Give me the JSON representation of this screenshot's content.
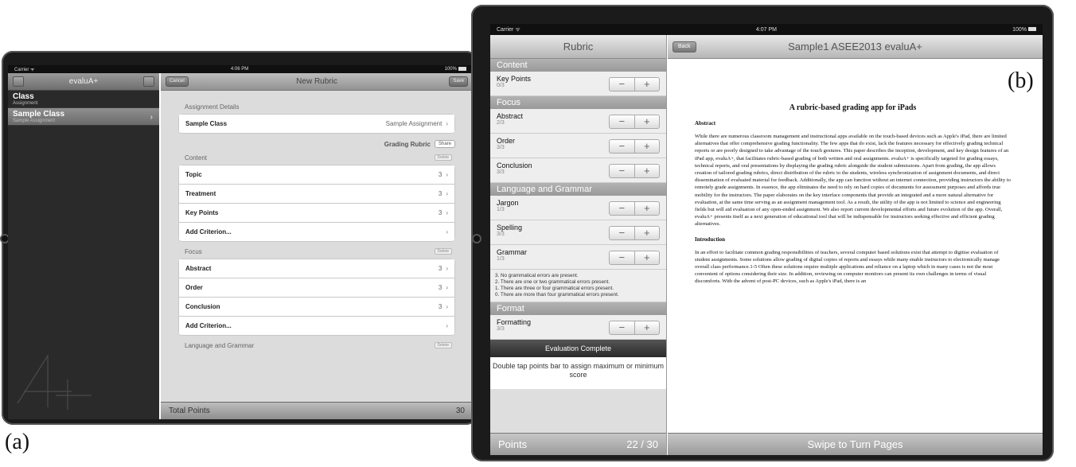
{
  "labels": {
    "a": "(a)",
    "b": "(b)"
  },
  "screen_a": {
    "status": {
      "carrier": "Carrier ᯤ",
      "time": "4:06 PM",
      "battery": "100%"
    },
    "sidebar": {
      "title": "evaluA+",
      "items": [
        {
          "title": "Class",
          "subtitle": "Assignment"
        },
        {
          "title": "Sample Class",
          "subtitle": "Sample Assignment",
          "chevron": "›"
        }
      ]
    },
    "nav": {
      "cancel": "Cancel",
      "title": "New Rubric",
      "save": "Save"
    },
    "assignment": {
      "header": "Assignment Details",
      "row": {
        "label": "Sample Class",
        "value": "Sample Assignment",
        "chevron": "›"
      }
    },
    "rubric": {
      "label": "Grading Rubric",
      "share": "Share"
    },
    "groups": [
      {
        "title": "Content",
        "delete": "Delete",
        "items": [
          {
            "label": "Topic",
            "value": "3",
            "chevron": "›"
          },
          {
            "label": "Treatment",
            "value": "3",
            "chevron": "›"
          },
          {
            "label": "Key Points",
            "value": "3",
            "chevron": "›"
          },
          {
            "label": "Add Criterion...",
            "value": "",
            "chevron": "›"
          }
        ]
      },
      {
        "title": "Focus",
        "delete": "Delete",
        "items": [
          {
            "label": "Abstract",
            "value": "3",
            "chevron": "›"
          },
          {
            "label": "Order",
            "value": "3",
            "chevron": "›"
          },
          {
            "label": "Conclusion",
            "value": "3",
            "chevron": "›"
          },
          {
            "label": "Add Criterion...",
            "value": "",
            "chevron": "›"
          }
        ]
      },
      {
        "title": "Language and Grammar",
        "delete": "Delete",
        "items": []
      }
    ],
    "total": {
      "label": "Total Points",
      "value": "30"
    }
  },
  "screen_b": {
    "status": {
      "carrier": "Carrier ᯤ",
      "time": "4:07 PM",
      "battery": "100%"
    },
    "sidebar": {
      "title": "Rubric",
      "sections": [
        {
          "name": "Content",
          "items": [
            {
              "name": "Key Points",
              "score": "0/3"
            }
          ]
        },
        {
          "name": "Focus",
          "items": [
            {
              "name": "Abstract",
              "score": "2/3"
            },
            {
              "name": "Order",
              "score": "3/3"
            },
            {
              "name": "Conclusion",
              "score": "3/3"
            }
          ]
        },
        {
          "name": "Language and Grammar",
          "items": [
            {
              "name": "Jargon",
              "score": "1/3"
            },
            {
              "name": "Spelling",
              "score": "3/3"
            },
            {
              "name": "Grammar",
              "score": "1/3"
            }
          ]
        },
        {
          "name": "Format",
          "items": [
            {
              "name": "Formatting",
              "score": "3/3"
            }
          ]
        }
      ],
      "grammar_notes": [
        "3. No grammatical errors are present.",
        "2. There are one or two grammatical errors present.",
        "1. There are three or four grammatical errors present.",
        "0. There are more than four grammatical errors present."
      ],
      "minus": "−",
      "plus": "+",
      "evaluation_complete": "Evaluation Complete",
      "hint": "Double tap points bar to assign maximum or minimum score",
      "points_label": "Points",
      "points_value": "22 / 30"
    },
    "nav": {
      "back": "Back",
      "title": "Sample1 ASEE2013 evaluA+"
    },
    "document": {
      "title": "A rubric-based grading app for iPads",
      "abstract_heading": "Abstract",
      "abstract_text": "While there are numerous classroom management and instructional apps available on the touch-based devices such as Apple's iPad, there are limited alternatives that offer comprehensive grading functionality. The few apps that do exist, lack the features necessary for effectively grading technical reports or are poorly designed to take advantage of the touch gestures. This paper describes the inception, development, and key design features of an iPad app, evaluA+, that facilitates rubric-based grading of both written and oral assignments. evaluA+ is specifically targeted for grading essays, technical reports, and oral presentations by displaying the grading rubric alongside the student submissions. Apart from grading, the app allows creation of tailored grading rubrics, direct distribution of the rubric to the students, wireless synchronization of assignment documents, and direct dissemination of evaluated material for feedback. Additionally, the app can function without an internet connection, providing instructors the ability to remotely grade assignments. In essence, the app eliminates the need to rely on hard copies of documents for assessment purposes and affords true mobility for the instructors. The paper elaborates on the key interface components that provide an integrated and a more natural alternative for evaluation, at the same time serving as an assignment management tool. As a result, the utility of the app is not limited to science and engineering fields but will aid evaluation of any open-ended assignment. We also report current developmental efforts and future evolution of the app. Overall, evaluA+ presents itself as a next generation of educational tool that will be indispensable for instructors seeking effective and efficient grading alternatives.",
      "intro_heading": "Introduction",
      "intro_text": "In an effort to facilitate common grading responsibilities of teachers, several computer based solutions exist that attempt to digitise evaluation of student assignments. Some solutions allow grading of digital copies of reports and essays while many enable instructors to electronically manage overall class performance.1-5 Often these solutions require multiple applications and reliance on a laptop which in many cases is not the most convenient of options considering their size. In addition, reviewing on computer monitors can present its own challenges in terms of visual discomforts. With the advent of post-PC devices, such as Apple's iPad, there is an"
    },
    "swipe": "Swipe to Turn Pages"
  }
}
